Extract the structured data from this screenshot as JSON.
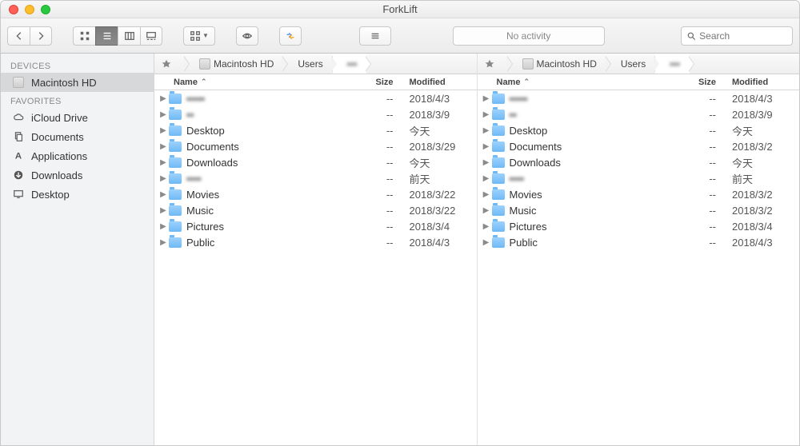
{
  "window": {
    "title": "ForkLift"
  },
  "toolbar": {
    "activity": "No activity",
    "search_placeholder": "Search"
  },
  "sidebar": {
    "sections": [
      {
        "header": "DEVICES",
        "items": [
          {
            "label": "Macintosh HD",
            "icon": "drive-icon",
            "active": true
          }
        ]
      },
      {
        "header": "FAVORITES",
        "items": [
          {
            "label": "iCloud Drive",
            "icon": "cloud-icon",
            "active": false
          },
          {
            "label": "Documents",
            "icon": "documents-icon",
            "active": false
          },
          {
            "label": "Applications",
            "icon": "applications-icon",
            "active": false
          },
          {
            "label": "Downloads",
            "icon": "downloads-icon",
            "active": false
          },
          {
            "label": "Desktop",
            "icon": "desktop-icon",
            "active": false
          }
        ]
      }
    ]
  },
  "columns": {
    "name": "Name",
    "size": "Size",
    "modified": "Modified"
  },
  "panes": [
    {
      "breadcrumbs": [
        {
          "label": "",
          "icon": "star"
        },
        {
          "label": "Macintosh HD",
          "icon": "drive"
        },
        {
          "label": "Users",
          "icon": ""
        },
        {
          "label": "▪▪▪",
          "icon": "",
          "active": true,
          "blur": true
        }
      ],
      "rows": [
        {
          "name": "▪▪▪▪▪",
          "blur": true,
          "size": "--",
          "modified": "2018/4/3"
        },
        {
          "name": "▪▪",
          "blur": true,
          "size": "--",
          "modified": "2018/3/9"
        },
        {
          "name": "Desktop",
          "size": "--",
          "modified": "今天"
        },
        {
          "name": "Documents",
          "size": "--",
          "modified": "2018/3/29"
        },
        {
          "name": "Downloads",
          "size": "--",
          "modified": "今天"
        },
        {
          "name": "▪▪▪▪",
          "blur": true,
          "size": "--",
          "modified": "前天"
        },
        {
          "name": "Movies",
          "size": "--",
          "modified": "2018/3/22"
        },
        {
          "name": "Music",
          "size": "--",
          "modified": "2018/3/22"
        },
        {
          "name": "Pictures",
          "size": "--",
          "modified": "2018/3/4"
        },
        {
          "name": "Public",
          "size": "--",
          "modified": "2018/4/3"
        }
      ]
    },
    {
      "breadcrumbs": [
        {
          "label": "",
          "icon": "star"
        },
        {
          "label": "Macintosh HD",
          "icon": "drive"
        },
        {
          "label": "Users",
          "icon": ""
        },
        {
          "label": "▪▪▪",
          "icon": "",
          "active": true,
          "blur": true
        }
      ],
      "rows": [
        {
          "name": "▪▪▪▪▪",
          "blur": true,
          "size": "--",
          "modified": "2018/4/3"
        },
        {
          "name": "▪▪",
          "blur": true,
          "size": "--",
          "modified": "2018/3/9"
        },
        {
          "name": "Desktop",
          "size": "--",
          "modified": "今天"
        },
        {
          "name": "Documents",
          "size": "--",
          "modified": "2018/3/2"
        },
        {
          "name": "Downloads",
          "size": "--",
          "modified": "今天"
        },
        {
          "name": "▪▪▪▪",
          "blur": true,
          "size": "--",
          "modified": "前天"
        },
        {
          "name": "Movies",
          "size": "--",
          "modified": "2018/3/2"
        },
        {
          "name": "Music",
          "size": "--",
          "modified": "2018/3/2"
        },
        {
          "name": "Pictures",
          "size": "--",
          "modified": "2018/3/4"
        },
        {
          "name": "Public",
          "size": "--",
          "modified": "2018/4/3"
        }
      ]
    }
  ]
}
